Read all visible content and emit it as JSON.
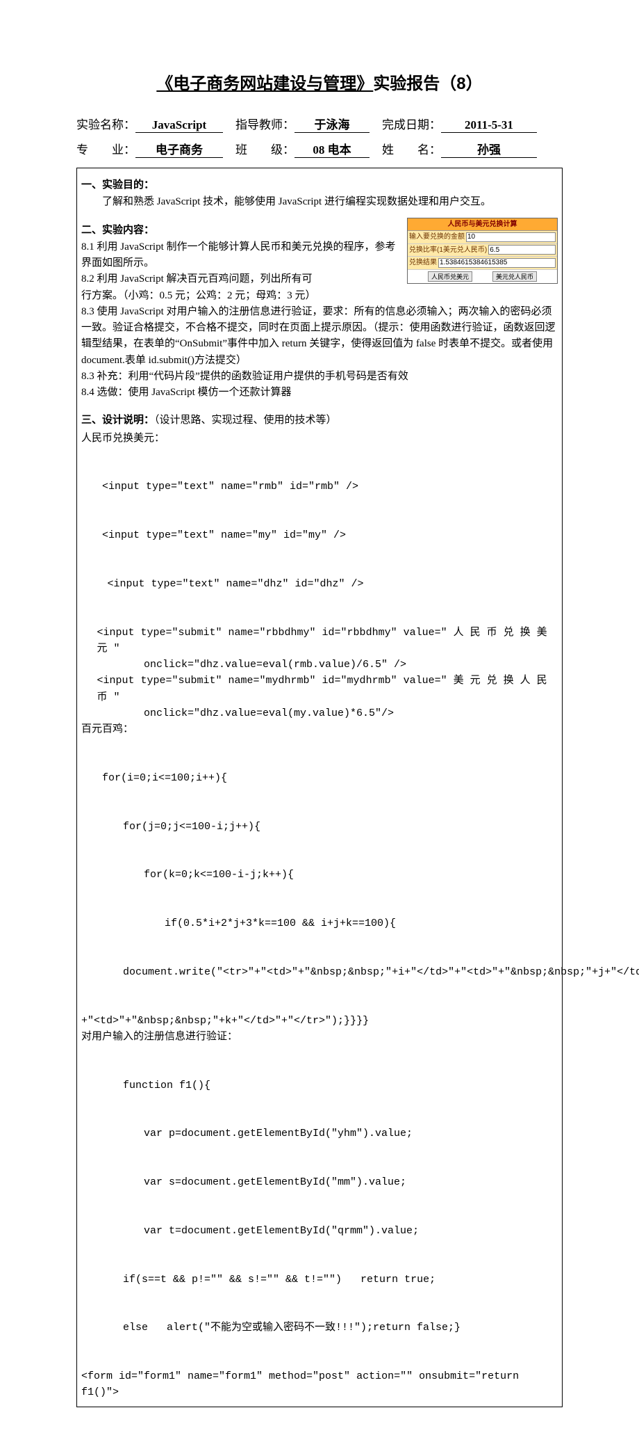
{
  "title_part1": "《电子商务网站建设与管理》",
  "title_part2": "实验报告（8）",
  "meta": {
    "l1a_label": "实验名称：",
    "l1a_value": "JavaScript",
    "l1b_label": "指导教师：",
    "l1b_value": "于泳海",
    "l1c_label": "完成日期：",
    "l1c_value": "2011-5-31",
    "l2a_label": "专　　业：",
    "l2a_value": "电子商务",
    "l2b_label": "班　　级：",
    "l2b_value": "08 电本",
    "l2c_label": "姓　　名：",
    "l2c_value": "孙强"
  },
  "sec1": {
    "title": "一、实验目的：",
    "body": "了解和熟悉 JavaScript 技术，能够使用 JavaScript 进行编程实现数据处理和用户交互。"
  },
  "widget": {
    "header": "人民币与美元兑换计算",
    "row1_label": "输入要兑换的金额",
    "row1_value": "10",
    "row2_label": "兑换比率(1美元兑人民币)",
    "row2_value": "6.5",
    "row3_label": "兑换结果",
    "row3_value": "1.5384615384615385",
    "btn1": "人民币兑美元",
    "btn2": "美元兑人民币"
  },
  "sec2": {
    "title": "二、实验内容：",
    "p81": "8.1 利用 JavaScript 制作一个能够计算人民币和美元兑换的程序，参考界面如图所示。",
    "p82a": "8.2 利用 JavaScript 解决百元百鸡问题，列出所有可",
    "p82b": "行方案。（小鸡：0.5 元；公鸡：2 元；母鸡：3 元）",
    "p83": "8.3 使用 JavaScript 对用户输入的注册信息进行验证，要求：所有的信息必须输入；两次输入的密码必须一致。验证合格提交，不合格不提交，同时在页面上提示原因。（提示：使用函数进行验证，函数返回逻辑型结果，在表单的“OnSubmit”事件中加入 return 关键字，使得返回值为 false 时表单不提交。或者使用 document.表单 id.submit()方法提交）",
    "p83b": "8.3 补充：利用“代码片段”提供的函数验证用户提供的手机号码是否有效",
    "p84": "8.4 选做：使用 JavaScript 模仿一个还款计算器"
  },
  "sec3": {
    "title": "三、设计说明：",
    "subtitle": "（设计思路、实现过程、使用的技术等）",
    "h1": "人民币兑换美元：",
    "c1_l1": "<input type=\"text\" name=\"rmb\" id=\"rmb\" />",
    "c1_l2": "<input type=\"text\" name=\"my\" id=\"my\" />",
    "c1_l3": "<input type=\"text\" name=\"dhz\" id=\"dhz\" />",
    "c1_l4a": "<input  type=\"submit\"  name=\"rbbdhmy\"  id=\"rbbdhmy\"  value=\" 人 民 币 兑 换 美 元 \"",
    "c1_l4b": "onclick=\"dhz.value=eval(rmb.value)/6.5\" />",
    "c1_l5a": "<input  type=\"submit\"  name=\"mydhrmb\"  id=\"mydhrmb\"  value=\" 美 元 兑 换 人 民 币 \"",
    "c1_l5b": "onclick=\"dhz.value=eval(my.value)*6.5\"/>",
    "h2": "百元百鸡：",
    "c2_l1": "for(i=0;i<=100;i++){",
    "c2_l2": "for(j=0;j<=100-i;j++){",
    "c2_l3": "for(k=0;k<=100-i-j;k++){",
    "c2_l4": "if(0.5*i+2*j+3*k==100 && i+j+k==100){",
    "c2_l5": "document.write(\"<tr>\"+\"<td>\"+\"&nbsp;&nbsp;\"+i+\"</td>\"+\"<td>\"+\"&nbsp;&nbsp;\"+j+\"</td>\"",
    "c2_l6": "+\"<td>\"+\"&nbsp;&nbsp;\"+k+\"</td>\"+\"</tr>\");}}}}",
    "h3": "对用户输入的注册信息进行验证：",
    "c3_l1": "function f1(){",
    "c3_l2": "var p=document.getElementById(\"yhm\").value;",
    "c3_l3": "var s=document.getElementById(\"mm\").value;",
    "c3_l4": "var t=document.getElementById(\"qrmm\").value;",
    "c3_l5": "if(s==t && p!=\"\" && s!=\"\" && t!=\"\")   return true;",
    "c3_l6": "else   alert(\"不能为空或输入密码不一致!!!\");return false;}",
    "c3_l7": "<form id=\"form1\" name=\"form1\" method=\"post\" action=\"\"  onsubmit=\"return f1()\">"
  }
}
